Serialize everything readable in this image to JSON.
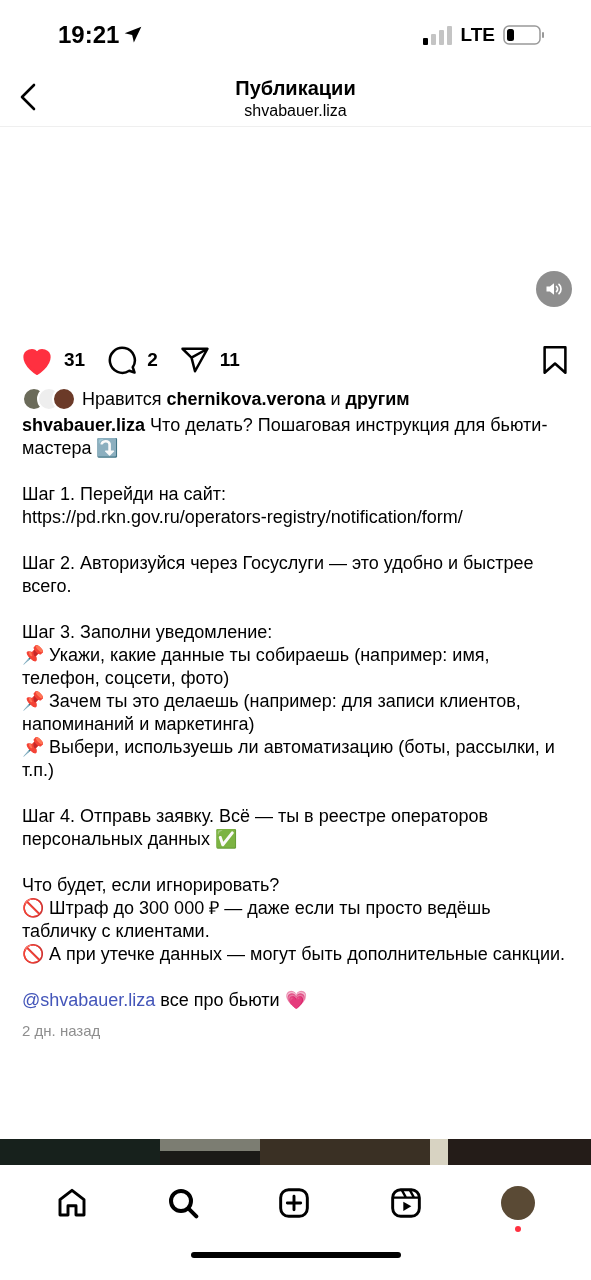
{
  "status_bar": {
    "time": "19:21",
    "network": "LTE"
  },
  "header": {
    "title": "Публикации",
    "subtitle": "shvabauer.liza"
  },
  "post": {
    "liked": true,
    "saved": false,
    "actions": [
      {
        "kind": "like",
        "count": "31"
      },
      {
        "kind": "comment",
        "count": "2"
      },
      {
        "kind": "share",
        "count": "11"
      }
    ],
    "likes_text": "Нравится **chernikova.verona** и **другим**",
    "caption": {
      "author": "shvabauer.liza",
      "paragraphs": [
        [
          "Что делать? Пошаговая инструкция для бьюти-мастера ⤵️"
        ],
        [
          "Шаг 1. Перейди на сайт:",
          "https://pd.rkn.gov.ru/operators-registry/notification/form/"
        ],
        [
          "Шаг 2. Авторизуйся через Госуслуги — это удобно и быстрее всего."
        ],
        [
          "Шаг 3. Заполни уведомление:",
          "📌 Укажи, какие данные ты собираешь (например: имя, телефон, соцсети, фото)",
          "📌 Зачем ты это делаешь (например: для записи клиентов, напоминаний и маркетинга)",
          "📌 Выбери, используешь ли автоматизацию (боты, рассылки, и т.п.)"
        ],
        [
          "Шаг 4. Отправь заявку. Всё — ты в реестре операторов персональных данных ✅"
        ],
        [
          "Что будет, если игнорировать?",
          "🚫 Штраф до 300 000 ₽ — даже если ты просто ведёшь табличку с клиентами.",
          "🚫 А при утечке данных — могут быть дополнительные санкции."
        ]
      ],
      "mention": "@shvabauer.liza",
      "tail": "все про бьюти 💗"
    },
    "time_ago": "2 дн. назад"
  },
  "tab_bar": {
    "items": [
      {
        "kind": "home",
        "selected": false
      },
      {
        "kind": "search",
        "selected": true
      },
      {
        "kind": "create",
        "selected": false
      },
      {
        "kind": "reels",
        "selected": false
      },
      {
        "kind": "profile",
        "selected": false
      }
    ],
    "profile_notification": true
  }
}
